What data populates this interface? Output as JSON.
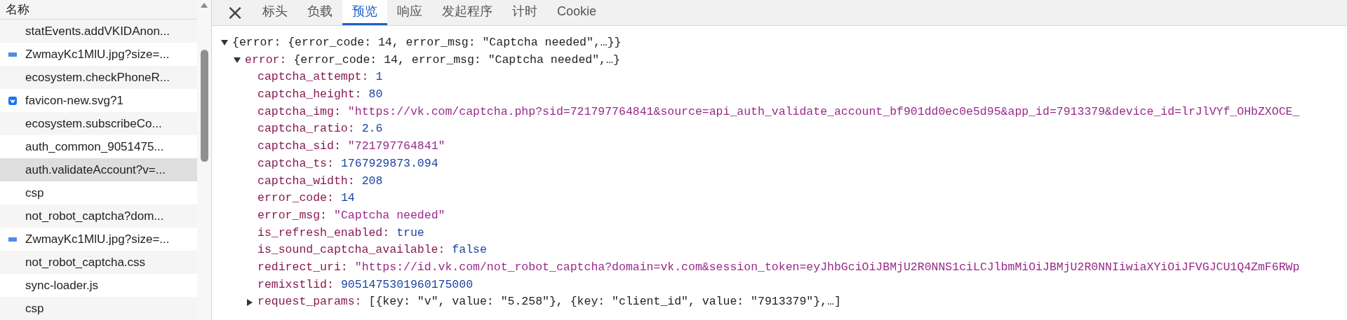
{
  "requests": {
    "header": "名称",
    "rows": [
      {
        "name": "statEvents.addVKIDAnon...",
        "kind": "plain",
        "selected": false
      },
      {
        "name": "ZwmayKc1MlU.jpg?size=...",
        "kind": "image",
        "selected": false
      },
      {
        "name": "ecosystem.checkPhoneR...",
        "kind": "plain",
        "selected": false
      },
      {
        "name": "favicon-new.svg?1",
        "kind": "favicon",
        "selected": false
      },
      {
        "name": "ecosystem.subscribeCo...",
        "kind": "plain",
        "selected": false
      },
      {
        "name": "auth_common_9051475...",
        "kind": "plain",
        "selected": false
      },
      {
        "name": "auth.validateAccount?v=...",
        "kind": "plain",
        "selected": true
      },
      {
        "name": "csp",
        "kind": "plain",
        "selected": false
      },
      {
        "name": "not_robot_captcha?dom...",
        "kind": "plain",
        "selected": false
      },
      {
        "name": "ZwmayKc1MlU.jpg?size=...",
        "kind": "image",
        "selected": false
      },
      {
        "name": "not_robot_captcha.css",
        "kind": "plain",
        "selected": false
      },
      {
        "name": "sync-loader.js",
        "kind": "plain",
        "selected": false
      },
      {
        "name": "csp",
        "kind": "plain",
        "selected": false
      }
    ]
  },
  "close_button": "×",
  "tabs": [
    {
      "label": "标头",
      "selected": false
    },
    {
      "label": "负载",
      "selected": false
    },
    {
      "label": "预览",
      "selected": true
    },
    {
      "label": "响应",
      "selected": false
    },
    {
      "label": "发起程序",
      "selected": false
    },
    {
      "label": "计时",
      "selected": false
    },
    {
      "label": "Cookie",
      "selected": false
    }
  ],
  "preview": {
    "tree": [
      {
        "summary": "{error: {error_code: 14, error_msg: \"Captcha needed\",…}}",
        "expanded": true,
        "children": [
          {
            "key": "error:",
            "summary": "{error_code: 14, error_msg: \"Captcha needed\",…}",
            "expanded": true,
            "children": [
              {
                "key": "captcha_attempt:",
                "value": "1",
                "kind": "number"
              },
              {
                "key": "captcha_height:",
                "value": "80",
                "kind": "number"
              },
              {
                "key": "captcha_img:",
                "value": "\"https://vk.com/captcha.php?sid=721797764841&source=api_auth_validate_account_bf901dd0ec0e5d95&app_id=7913379&device_id=lrJlVYf_OHbZXOCE_",
                "kind": "string"
              },
              {
                "key": "captcha_ratio:",
                "value": "2.6",
                "kind": "number"
              },
              {
                "key": "captcha_sid:",
                "value": "\"721797764841\"",
                "kind": "string"
              },
              {
                "key": "captcha_ts:",
                "value": "1767929873.094",
                "kind": "number"
              },
              {
                "key": "captcha_width:",
                "value": "208",
                "kind": "number"
              },
              {
                "key": "error_code:",
                "value": "14",
                "kind": "number"
              },
              {
                "key": "error_msg:",
                "value": "\"Captcha needed\"",
                "kind": "string"
              },
              {
                "key": "is_refresh_enabled:",
                "value": "true",
                "kind": "boolean"
              },
              {
                "key": "is_sound_captcha_available:",
                "value": "false",
                "kind": "boolean"
              },
              {
                "key": "redirect_uri:",
                "value": "\"https://id.vk.com/not_robot_captcha?domain=vk.com&session_token=eyJhbGciOiJBMjU2R0NNS1ciLCJlbmMiOiJBMjU2R0NNIiwiaXYiOiJFVGJCU1Q4ZmF6RWp",
                "kind": "string"
              },
              {
                "key": "remixstlid:",
                "value": "9051475301960175000",
                "kind": "number"
              },
              {
                "key": "request_params:",
                "summary": "[{key: \"v\", value: \"5.258\"}, {key: \"client_id\", value: \"7913379\"},…]",
                "expanded": false
              }
            ]
          }
        ]
      }
    ]
  }
}
